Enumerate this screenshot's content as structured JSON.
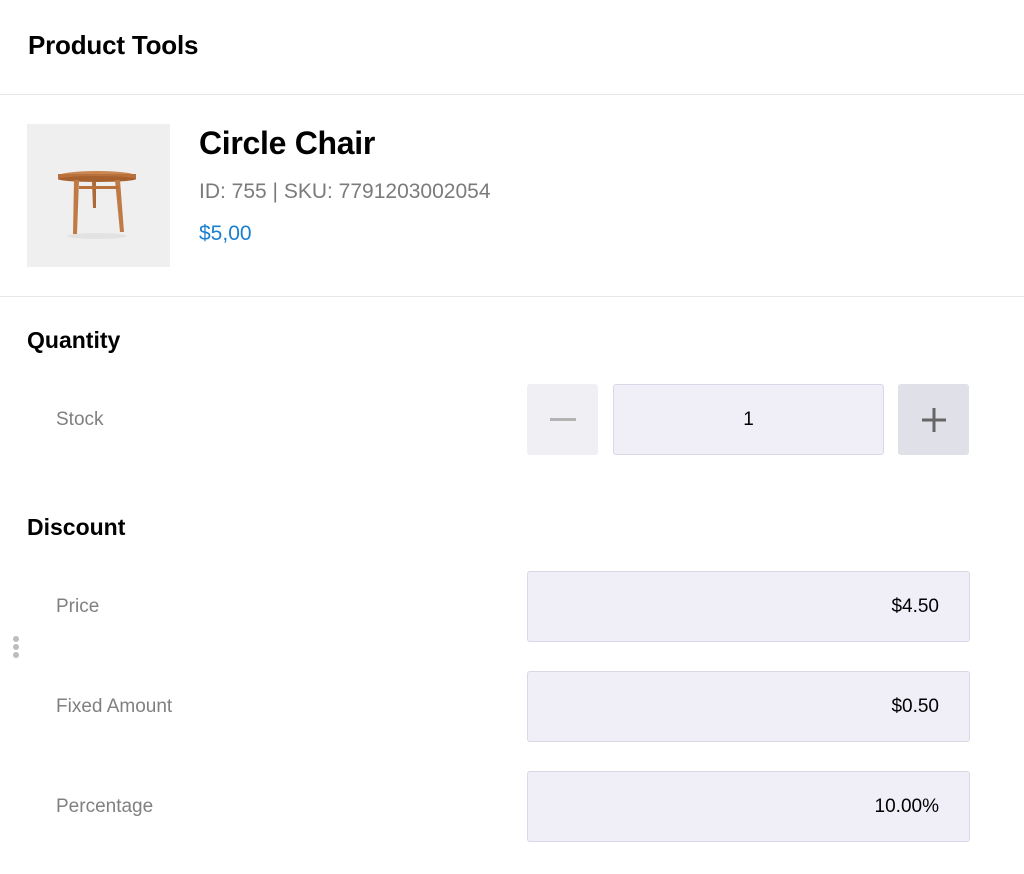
{
  "header": {
    "title": "Product Tools"
  },
  "product": {
    "name": "Circle Chair",
    "meta": "ID: 755 | SKU: 7791203002054",
    "price": "$5,00",
    "image_icon": "round-table-image"
  },
  "quantity": {
    "title": "Quantity",
    "stock_label": "Stock",
    "value": "1",
    "decrement_icon": "minus-icon",
    "increment_icon": "plus-icon"
  },
  "discount": {
    "title": "Discount",
    "rows": [
      {
        "label": "Price",
        "value": "$4.50"
      },
      {
        "label": "Fixed Amount",
        "value": "$0.50"
      },
      {
        "label": "Percentage",
        "value": "10.00%"
      }
    ]
  },
  "colors": {
    "price_accent": "#1a7fd1",
    "field_bg": "#f0eff8",
    "muted_text": "#808080"
  }
}
